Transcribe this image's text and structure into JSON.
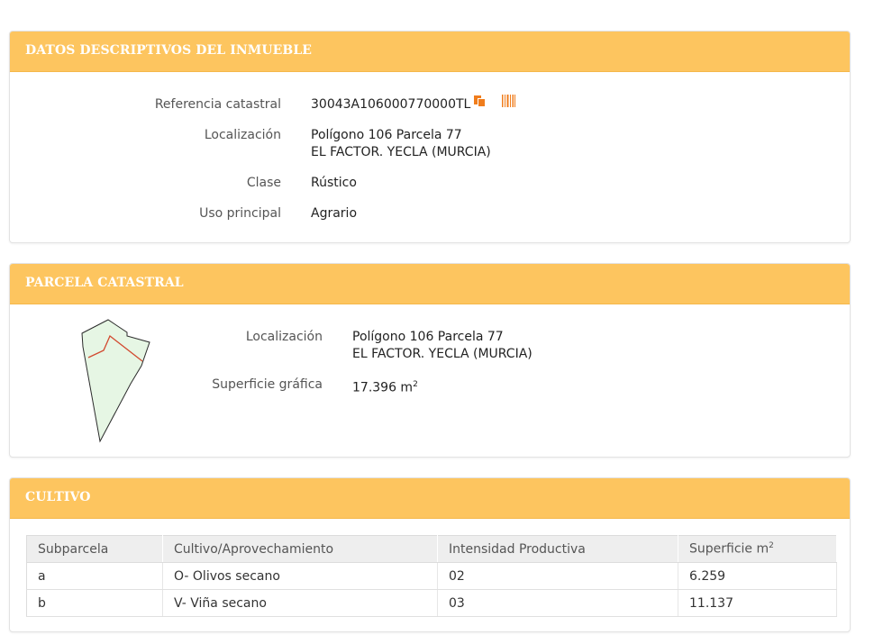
{
  "colors": {
    "header_bg": "#fdc55f",
    "header_text": "#ffffff",
    "icon_orange": "#f07d1c",
    "parcel_fill": "#e6f6e4",
    "parcel_line": "#d2492f"
  },
  "datos": {
    "title": "DATOS DESCRIPTIVOS DEL INMUEBLE",
    "ref_label": "Referencia catastral",
    "ref_value": "30043A106000770000TL",
    "loc_label": "Localización",
    "loc_line1": "Polígono 106 Parcela 77",
    "loc_line2": "EL FACTOR. YECLA (MURCIA)",
    "clase_label": "Clase",
    "clase_value": "Rústico",
    "uso_label": "Uso principal",
    "uso_value": "Agrario"
  },
  "parcela": {
    "title": "PARCELA CATASTRAL",
    "loc_label": "Localización",
    "loc_line1": "Polígono 106 Parcela 77",
    "loc_line2": "EL FACTOR. YECLA (MURCIA)",
    "sup_label": "Superficie gráfica",
    "sup_value": "17.396 m",
    "sup_unit_exp": "2"
  },
  "cultivo": {
    "title": "CULTIVO",
    "headers": [
      "Subparcela",
      "Cultivo/Aprovechamiento",
      "Intensidad Productiva",
      "Superficie m"
    ],
    "header_exp": "2",
    "rows": [
      [
        "a",
        "O- Olivos secano",
        "02",
        "6.259"
      ],
      [
        "b",
        "V- Viña secano",
        "03",
        "11.137"
      ]
    ]
  },
  "icons": {
    "copy": "copy-icon",
    "barcode": "barcode-icon",
    "parcel_map": "parcel-map-icon"
  }
}
